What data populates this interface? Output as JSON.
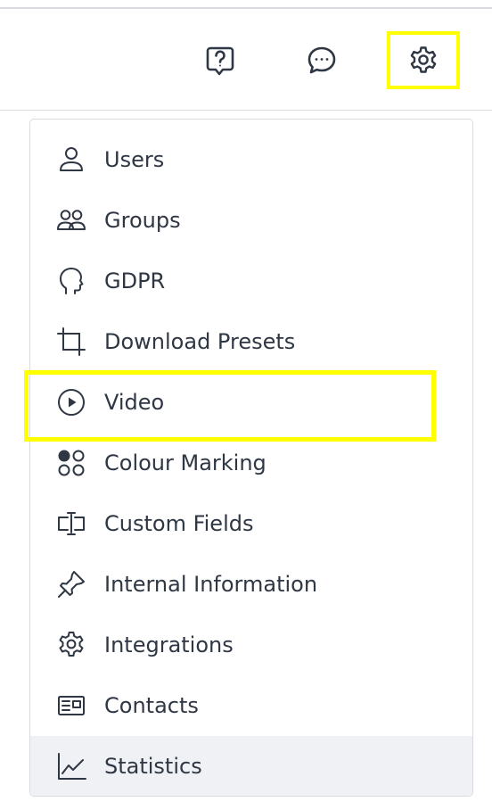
{
  "header": {
    "help_icon": "question-bubble-icon",
    "chat_icon": "chat-bubble-icon",
    "settings_icon": "gear-icon"
  },
  "colors": {
    "highlight": "#ffff00",
    "hover_bg": "#f0f1f4",
    "border": "#d9dbe0",
    "text": "#2f3744"
  },
  "menu": {
    "items": [
      {
        "label": "Users",
        "icon": "user-icon"
      },
      {
        "label": "Groups",
        "icon": "group-icon"
      },
      {
        "label": "GDPR",
        "icon": "head-profile-icon"
      },
      {
        "label": "Download Presets",
        "icon": "crop-icon"
      },
      {
        "label": "Video",
        "icon": "play-circle-icon"
      },
      {
        "label": "Colour Marking",
        "icon": "color-dots-icon"
      },
      {
        "label": "Custom Fields",
        "icon": "text-cursor-field-icon"
      },
      {
        "label": "Internal Information",
        "icon": "pin-icon"
      },
      {
        "label": "Integrations",
        "icon": "gear-icon"
      },
      {
        "label": "Contacts",
        "icon": "contact-card-icon"
      },
      {
        "label": "Statistics",
        "icon": "line-chart-icon"
      }
    ]
  }
}
